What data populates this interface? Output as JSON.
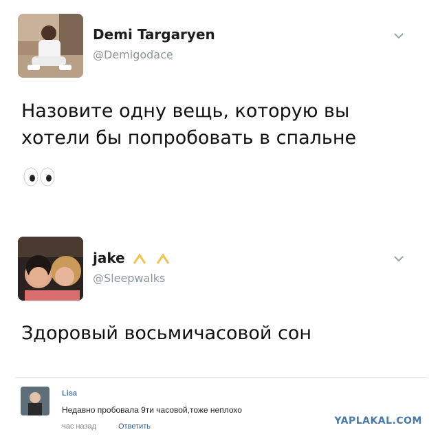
{
  "tweets": [
    {
      "name": "Demi Targaryen",
      "handle": "@Demigodace",
      "text_line1": "Назовите одну вещь, которую вы",
      "text_line2": "хотели бы попробовать в спальне",
      "emoji": "eyes"
    },
    {
      "name": "jake",
      "name_emoji": "^ ^",
      "handle": "@Sleepwalks",
      "text_line1": "Здоровый восьмичасовой сон"
    }
  ],
  "comment": {
    "author": "Lisa",
    "text": "Недавно пробовала 9ти часовой,тоже неплохо",
    "time": "час назад",
    "reply_label": "Ответить"
  },
  "watermark": "YAPLAKAL.COM",
  "colors": {
    "handle": "#8b969f",
    "link": "#2e5f91",
    "watermark": "#4a7aa8"
  }
}
